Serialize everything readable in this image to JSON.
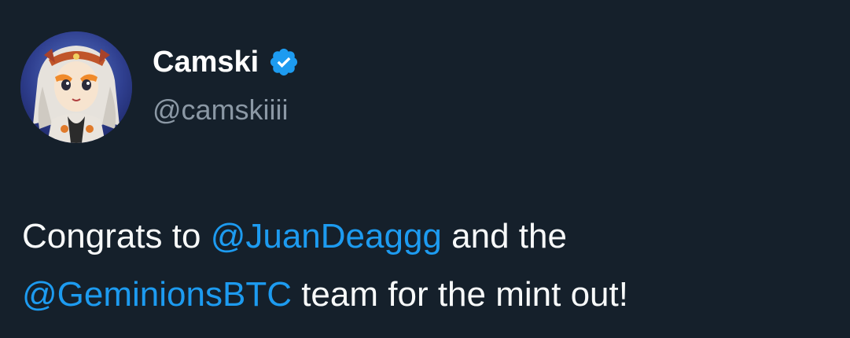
{
  "author": {
    "display_name": "Camski",
    "handle": "@camskiiii",
    "verified": true,
    "verified_icon": "verified-badge-icon",
    "avatar": "anime-character-avatar"
  },
  "tweet": {
    "text_part1": "Congrats to ",
    "mention1": "@JuanDeaggg",
    "text_part2": " and the",
    "mention2": "@GeminionsBTC",
    "text_part3": " team for the mint out!"
  },
  "colors": {
    "background": "#15202b",
    "text": "#f7f9f9",
    "secondary_text": "#8b98a5",
    "accent": "#1d9bf0"
  }
}
